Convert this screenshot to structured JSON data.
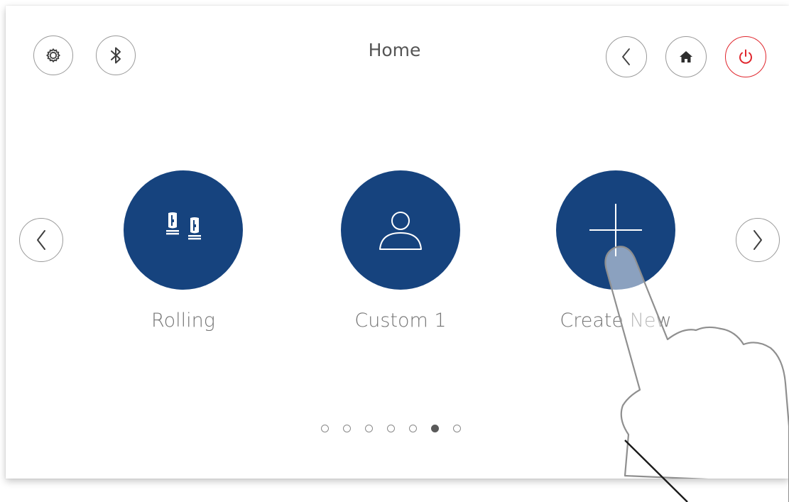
{
  "header": {
    "title": "Home",
    "left_buttons": [
      {
        "name": "settings",
        "icon": "gear-icon"
      },
      {
        "name": "bluetooth",
        "icon": "bluetooth-icon"
      }
    ],
    "right_buttons": [
      {
        "name": "back",
        "icon": "chevron-left-icon"
      },
      {
        "name": "home",
        "icon": "home-icon"
      },
      {
        "name": "power",
        "icon": "power-icon",
        "color": "#e0262d"
      }
    ]
  },
  "carousel": {
    "prev_icon": "chevron-left-icon",
    "next_icon": "chevron-right-icon",
    "tiles": [
      {
        "label": "Rolling",
        "icon": "massage-rollers-icon"
      },
      {
        "label": "Custom 1",
        "icon": "user-icon"
      },
      {
        "label": "Create New",
        "icon": "plus-icon"
      }
    ]
  },
  "pagination": {
    "total": 7,
    "active_index": 5
  },
  "overlay": {
    "icon": "hand-pointer-icon"
  },
  "colors": {
    "tile": "#16437e",
    "power": "#e0262d",
    "text": "#555555"
  }
}
